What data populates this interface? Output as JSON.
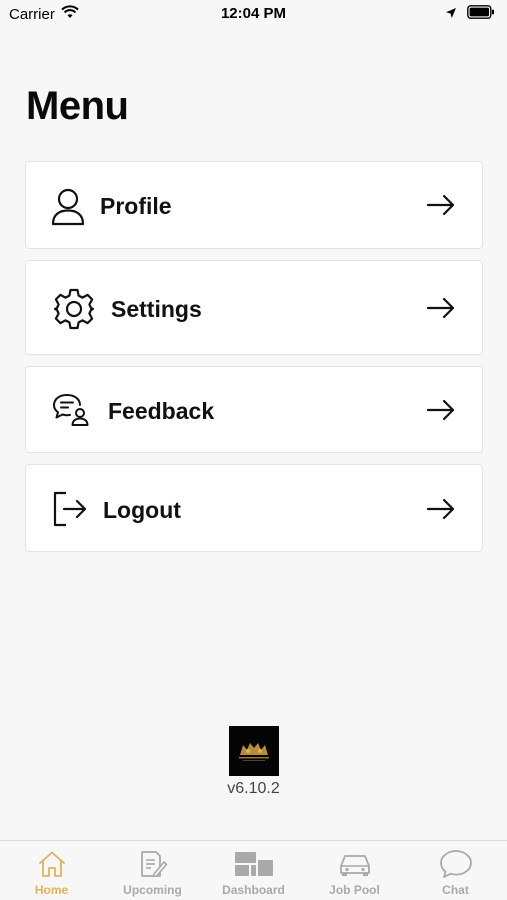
{
  "status_bar": {
    "carrier": "Carrier",
    "time": "12:04 PM"
  },
  "page": {
    "title": "Menu"
  },
  "menu": {
    "items": [
      {
        "label": "Profile",
        "icon": "person-icon"
      },
      {
        "label": "Settings",
        "icon": "gear-icon"
      },
      {
        "label": "Feedback",
        "icon": "feedback-chat-icon"
      },
      {
        "label": "Logout",
        "icon": "logout-icon"
      }
    ]
  },
  "footer": {
    "version": "v6.10.2"
  },
  "tabs": [
    {
      "label": "Home",
      "icon": "home-icon",
      "active": true
    },
    {
      "label": "Upcoming",
      "icon": "document-edit-icon",
      "active": false
    },
    {
      "label": "Dashboard",
      "icon": "dashboard-grid-icon",
      "active": false
    },
    {
      "label": "Job Pool",
      "icon": "car-icon",
      "active": false
    },
    {
      "label": "Chat",
      "icon": "chat-bubble-icon",
      "active": false
    }
  ],
  "colors": {
    "accent": "#e0b455",
    "inactive": "#a9a9a9",
    "background": "#f7f7f7"
  }
}
